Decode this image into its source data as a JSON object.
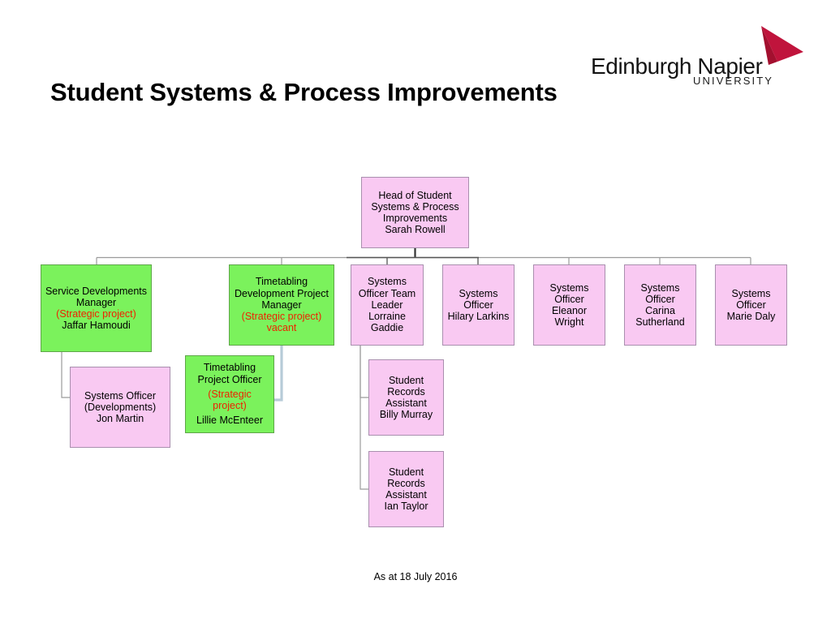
{
  "slide": {
    "title": "Student Systems & Process Improvements",
    "footer_date": "As at 18 July 2016"
  },
  "logo": {
    "wordmark": "Edinburgh Napier",
    "subword": "UNIVERSITY",
    "arrow_color": "#c0143c",
    "text_color": "#141414"
  },
  "colors": {
    "pink_fill": "#f9c9f2",
    "pink_border": "#a98fae",
    "green_fill": "#7bf25c",
    "green_border": "#5ea648",
    "strategic_text": "#ee2200",
    "connector": "#8c8c8c",
    "connector_dark": "#333333",
    "connector_blue": "#b7cbd8"
  },
  "chart_data": {
    "type": "diagram",
    "title": "Student Systems & Process Improvements",
    "subtitle": "As at 18 July 2016",
    "nodes": [
      {
        "id": "head",
        "role": "Head of Student Systems & Process Improvements",
        "role_lines": [
          "Head of Student",
          "Systems & Process",
          "Improvements"
        ],
        "name": "Sarah Rowell",
        "flag": "",
        "vacant": "",
        "fill": "pink",
        "parent": null
      },
      {
        "id": "service-dev-manager",
        "role": "Service Developments Manager",
        "role_lines": [
          "Service Developments",
          "Manager"
        ],
        "name": "Jaffar Hamoudi",
        "flag": "(Strategic project)",
        "vacant": "",
        "fill": "green",
        "parent": "head"
      },
      {
        "id": "timetabling-dev-manager",
        "role": "Timetabling Development Project Manager",
        "role_lines": [
          "Timetabling",
          "Development Project",
          "Manager"
        ],
        "name": "",
        "flag": "(Strategic project)",
        "vacant": "vacant",
        "fill": "green",
        "parent": "head"
      },
      {
        "id": "systems-officer-team-leader",
        "role": "Systems Officer Team Leader",
        "role_lines": [
          "Systems",
          "Officer Team",
          "Leader"
        ],
        "name": "Lorraine Gaddie",
        "name_lines": [
          "Lorraine",
          "Gaddie"
        ],
        "flag": "",
        "vacant": "",
        "fill": "pink",
        "parent": "head"
      },
      {
        "id": "systems-officer-hilary",
        "role": "Systems Officer",
        "role_lines": [
          "Systems",
          "Officer"
        ],
        "name": "Hilary Larkins",
        "name_lines": [
          "Hilary Larkins"
        ],
        "flag": "",
        "vacant": "",
        "fill": "pink",
        "parent": "head"
      },
      {
        "id": "systems-officer-eleanor",
        "role": "Systems Officer",
        "role_lines": [
          "Systems",
          "Officer"
        ],
        "name": "Eleanor Wright",
        "name_lines": [
          "Eleanor",
          "Wright"
        ],
        "flag": "",
        "vacant": "",
        "fill": "pink",
        "parent": "head"
      },
      {
        "id": "systems-officer-carina",
        "role": "Systems Officer",
        "role_lines": [
          "Systems",
          "Officer"
        ],
        "name": "Carina Sutherland",
        "name_lines": [
          "Carina",
          "Sutherland"
        ],
        "flag": "",
        "vacant": "",
        "fill": "pink",
        "parent": "head"
      },
      {
        "id": "systems-officer-marie",
        "role": "Systems Officer",
        "role_lines": [
          "Systems",
          "Officer"
        ],
        "name": "Marie Daly",
        "name_lines": [
          "Marie Daly"
        ],
        "flag": "",
        "vacant": "",
        "fill": "pink",
        "parent": "head"
      },
      {
        "id": "systems-officer-developments",
        "role": "Systems Officer (Developments)",
        "role_lines": [
          "Systems Officer",
          "(Developments)"
        ],
        "name": "Jon Martin",
        "flag": "",
        "vacant": "",
        "fill": "pink",
        "parent": "service-dev-manager"
      },
      {
        "id": "timetabling-project-officer",
        "role": "Timetabling Project Officer",
        "role_lines": [
          "Timetabling",
          "Project Officer"
        ],
        "name": "Lillie McEnteer",
        "flag": "(Strategic project)",
        "flag_lines": [
          "(Strategic",
          "project)"
        ],
        "vacant": "",
        "fill": "green",
        "parent": "timetabling-dev-manager"
      },
      {
        "id": "student-records-billy",
        "role": "Student Records Assistant",
        "role_lines": [
          "Student",
          "Records",
          "Assistant"
        ],
        "name": "Billy Murray",
        "flag": "",
        "vacant": "",
        "fill": "pink",
        "parent": "systems-officer-team-leader"
      },
      {
        "id": "student-records-ian",
        "role": "Student Records Assistant",
        "role_lines": [
          "Student",
          "Records",
          "Assistant"
        ],
        "name": "Ian Taylor",
        "flag": "",
        "vacant": "",
        "fill": "pink",
        "parent": "systems-officer-team-leader"
      }
    ]
  }
}
